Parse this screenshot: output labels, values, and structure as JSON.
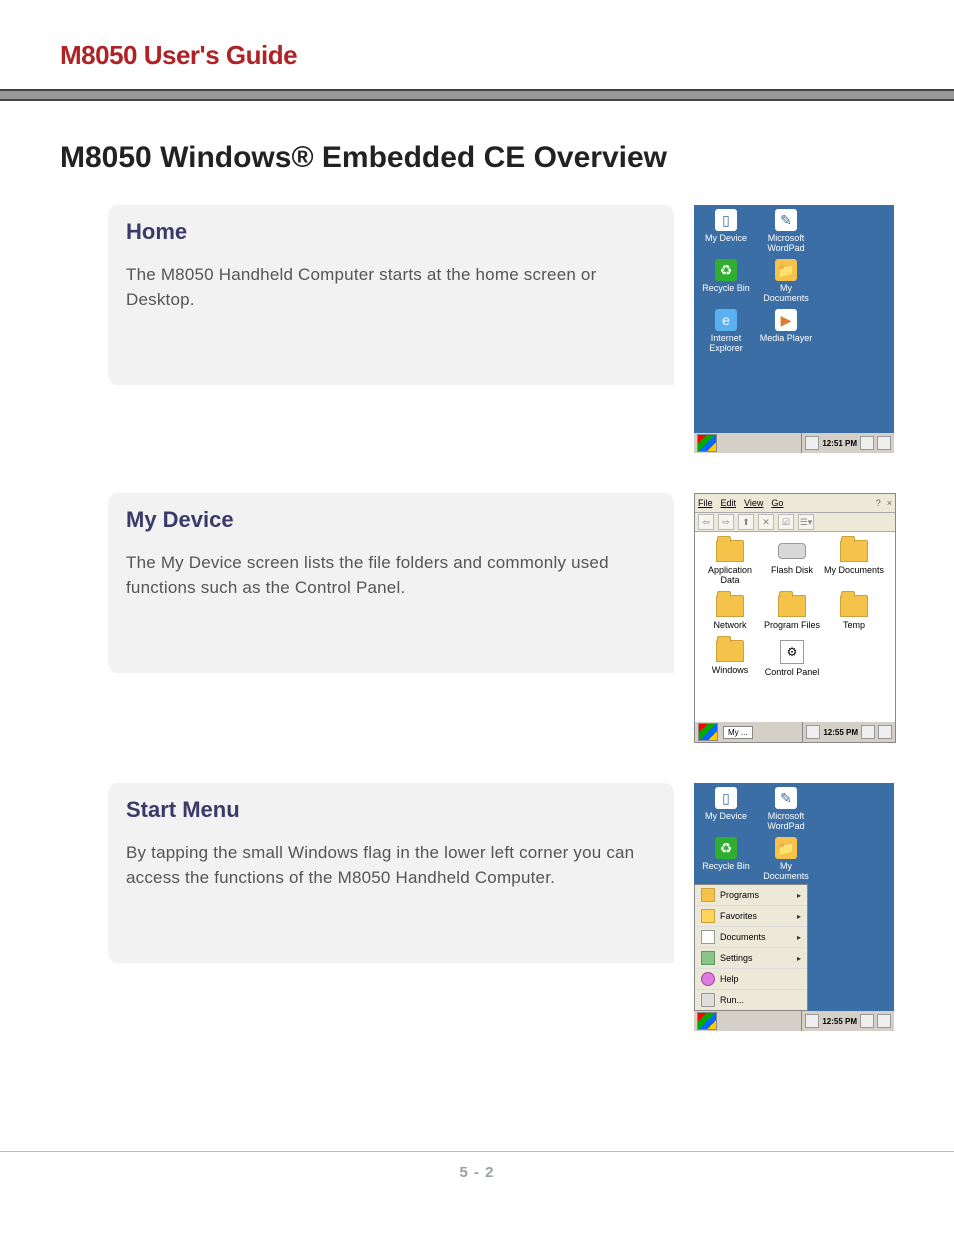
{
  "header": {
    "title": "M8050 User's Guide"
  },
  "section_title": "M8050 Windows® Embedded CE Overview",
  "cards": {
    "home": {
      "title": "Home",
      "body": "The M8050 Handheld Computer starts at the home screen or Desktop."
    },
    "mydevice": {
      "title": "My Device",
      "body": "The My Device screen lists the file folders and commonly used functions such as the Control Panel."
    },
    "startmenu": {
      "title": "Start Menu",
      "body": "By tapping the small Windows flag in the lower left corner you can access the functions of the M8050 Handheld Computer."
    }
  },
  "desktop_icons": {
    "my_device": "My Device",
    "wordpad": "Microsoft WordPad",
    "recycle": "Recycle Bin",
    "my_documents": "My Documents",
    "ie": "Internet Explorer",
    "media_player": "Media Player"
  },
  "taskbar": {
    "time_home": "12:51 PM",
    "time_mydevice": "12:55 PM",
    "time_startmenu": "12:55 PM",
    "task_my": "My ..."
  },
  "explorer": {
    "menu": {
      "file": "File",
      "edit": "Edit",
      "view": "View",
      "go": "Go"
    },
    "help_glyph": "?",
    "close_glyph": "×",
    "folders": {
      "app_data": "Application Data",
      "flash_disk": "Flash Disk",
      "my_documents": "My Documents",
      "network": "Network",
      "program_files": "Program Files",
      "temp": "Temp",
      "windows": "Windows",
      "control_panel": "Control Panel"
    }
  },
  "start_menu_items": {
    "programs": "Programs",
    "favorites": "Favorites",
    "documents": "Documents",
    "settings": "Settings",
    "help": "Help",
    "run": "Run..."
  },
  "footer": {
    "page_number": "5 - 2"
  }
}
